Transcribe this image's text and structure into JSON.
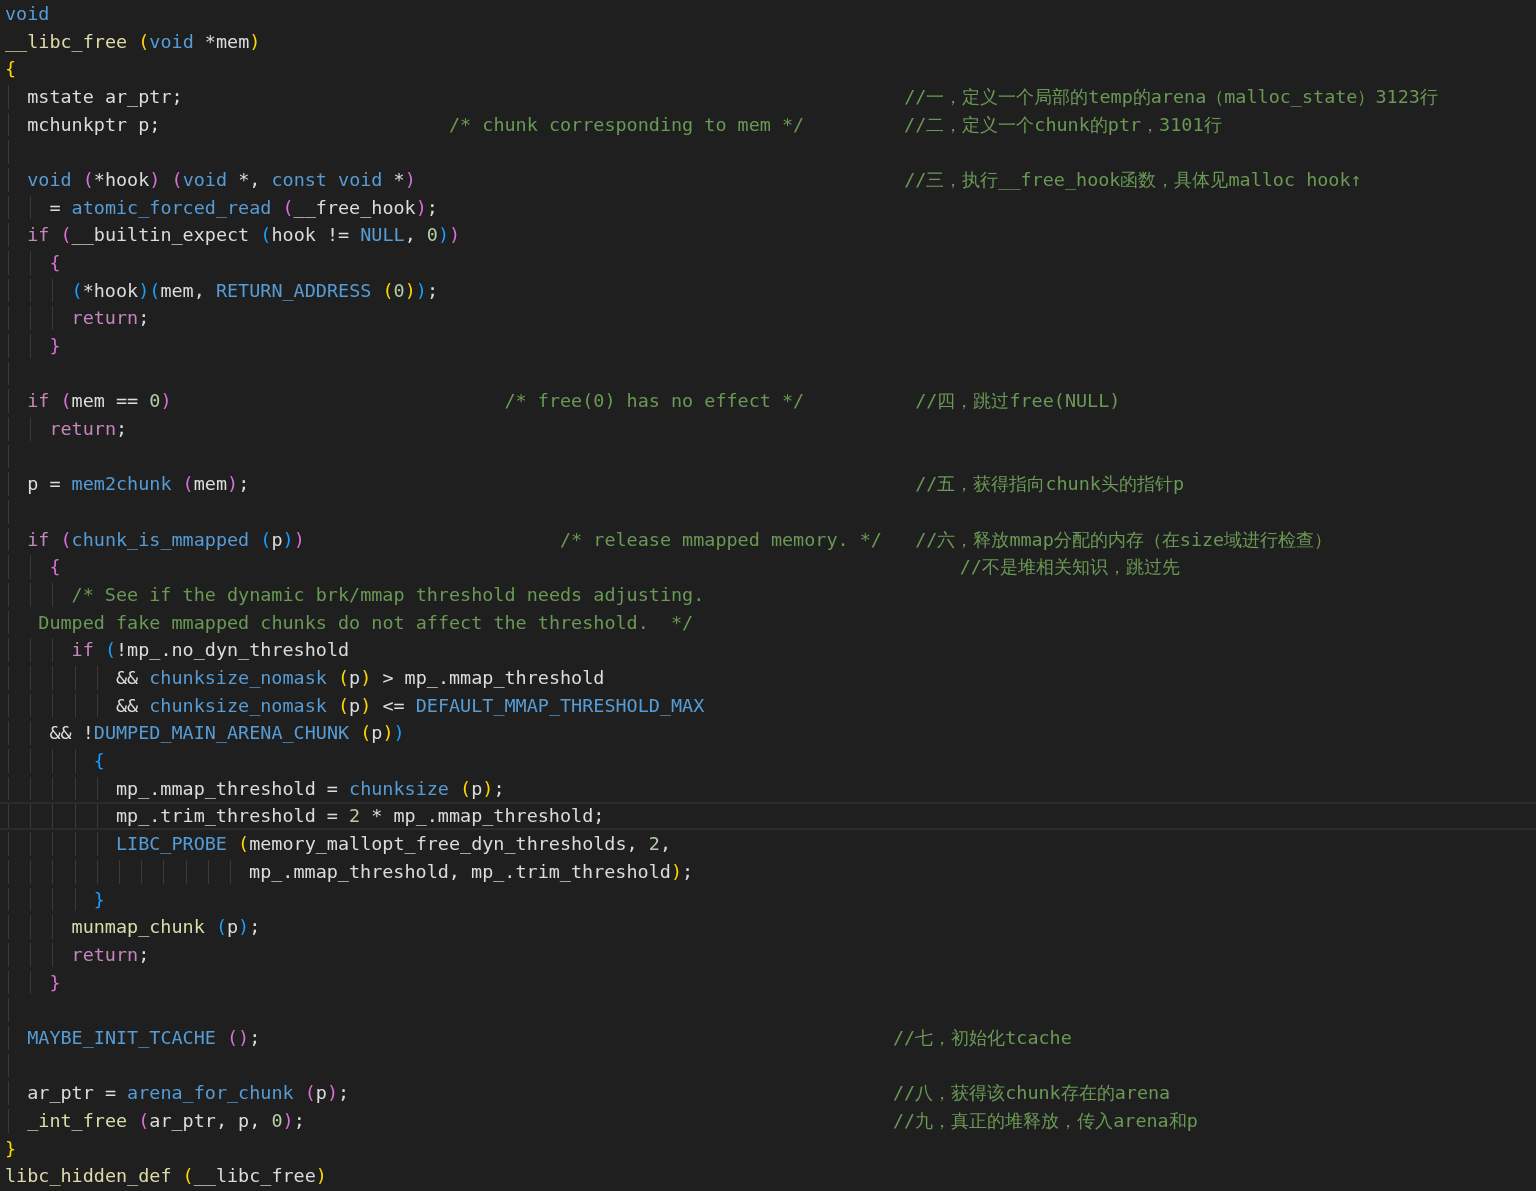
{
  "lines": [
    {
      "current": false,
      "tokens": [
        {
          "kind": "keyword",
          "text": "void"
        }
      ]
    },
    {
      "current": false,
      "tokens": [
        {
          "kind": "function",
          "text": "__libc_free "
        },
        {
          "kind": "bracket1",
          "text": "("
        },
        {
          "kind": "keyword",
          "text": "void"
        },
        {
          "kind": "plain",
          "text": " *mem"
        },
        {
          "kind": "bracket1",
          "text": ")"
        }
      ]
    },
    {
      "current": false,
      "tokens": [
        {
          "kind": "bracket1",
          "text": "{"
        }
      ]
    },
    {
      "current": false,
      "tokens": [
        {
          "kind": "plain",
          "text": "mstate ar_ptr;"
        }
      ],
      "note": "//一，定义一个局部的temp的arena（malloc_state）3123行"
    },
    {
      "current": false,
      "tokens": [
        {
          "kind": "plain",
          "text": "mchunkptr p;"
        }
      ],
      "comment": "/* chunk corresponding to mem */",
      "note": "//二，定义一个chunk的ptr，3101行"
    },
    {
      "current": false
    },
    {
      "current": false,
      "tokens": [
        {
          "kind": "keyword",
          "text": "void "
        },
        {
          "kind": "bracket2",
          "text": "("
        },
        {
          "kind": "plain",
          "text": "*hook"
        },
        {
          "kind": "bracket2",
          "text": ") "
        },
        {
          "kind": "bracket2",
          "text": "("
        },
        {
          "kind": "keyword",
          "text": "void"
        },
        {
          "kind": "plain",
          "text": " *, "
        },
        {
          "kind": "keyword",
          "text": "const void"
        },
        {
          "kind": "plain",
          "text": " *"
        },
        {
          "kind": "bracket2",
          "text": ")"
        }
      ],
      "note": "//三，执行__free_hook函数，具体见malloc hook↑"
    },
    {
      "current": false,
      "tokens": [
        {
          "kind": "plain",
          "text": "= "
        },
        {
          "kind": "macro",
          "text": "atomic_forced_read "
        },
        {
          "kind": "bracket2",
          "text": "("
        },
        {
          "kind": "plain",
          "text": "__free_hook"
        },
        {
          "kind": "bracket2",
          "text": ")"
        },
        {
          "kind": "plain",
          "text": ";"
        }
      ]
    },
    {
      "current": false,
      "tokens": [
        {
          "kind": "control",
          "text": "if "
        },
        {
          "kind": "bracket2",
          "text": "("
        },
        {
          "kind": "plain",
          "text": "__builtin_expect "
        },
        {
          "kind": "bracket3",
          "text": "("
        },
        {
          "kind": "plain",
          "text": "hook != "
        },
        {
          "kind": "macro",
          "text": "NULL"
        },
        {
          "kind": "plain",
          "text": ", "
        },
        {
          "kind": "number",
          "text": "0"
        },
        {
          "kind": "bracket3",
          "text": ")"
        },
        {
          "kind": "bracket2",
          "text": ")"
        }
      ]
    },
    {
      "current": false,
      "tokens": [
        {
          "kind": "bracket2",
          "text": "{"
        }
      ]
    },
    {
      "current": false,
      "tokens": [
        {
          "kind": "bracket3",
          "text": "("
        },
        {
          "kind": "plain",
          "text": "*hook"
        },
        {
          "kind": "bracket3",
          "text": ")"
        },
        {
          "kind": "bracket3",
          "text": "("
        },
        {
          "kind": "plain",
          "text": "mem, "
        },
        {
          "kind": "macro",
          "text": "RETURN_ADDRESS "
        },
        {
          "kind": "bracket1",
          "text": "("
        },
        {
          "kind": "number",
          "text": "0"
        },
        {
          "kind": "bracket1",
          "text": ")"
        },
        {
          "kind": "bracket3",
          "text": ")"
        },
        {
          "kind": "plain",
          "text": ";"
        }
      ]
    },
    {
      "current": false,
      "tokens": [
        {
          "kind": "control",
          "text": "return"
        },
        {
          "kind": "plain",
          "text": ";"
        }
      ]
    },
    {
      "current": false,
      "tokens": [
        {
          "kind": "bracket2",
          "text": "}"
        }
      ]
    },
    {
      "current": false
    },
    {
      "current": false,
      "tokens": [
        {
          "kind": "control",
          "text": "if "
        },
        {
          "kind": "bracket2",
          "text": "("
        },
        {
          "kind": "plain",
          "text": "mem == "
        },
        {
          "kind": "number",
          "text": "0"
        },
        {
          "kind": "bracket2",
          "text": ")"
        }
      ],
      "comment": "/* free(0) has no effect */",
      "note": "//四，跳过free(NULL)"
    },
    {
      "current": false,
      "tokens": [
        {
          "kind": "control",
          "text": "return"
        },
        {
          "kind": "plain",
          "text": ";"
        }
      ]
    },
    {
      "current": false
    },
    {
      "current": false,
      "tokens": [
        {
          "kind": "plain",
          "text": "p = "
        },
        {
          "kind": "macro",
          "text": "mem2chunk "
        },
        {
          "kind": "bracket2",
          "text": "("
        },
        {
          "kind": "plain",
          "text": "mem"
        },
        {
          "kind": "bracket2",
          "text": ")"
        },
        {
          "kind": "plain",
          "text": ";"
        }
      ],
      "note": "//五，获得指向chunk头的指针p"
    },
    {
      "current": false
    },
    {
      "current": false,
      "tokens": [
        {
          "kind": "control",
          "text": "if "
        },
        {
          "kind": "bracket2",
          "text": "("
        },
        {
          "kind": "macro",
          "text": "chunk_is_mmapped "
        },
        {
          "kind": "bracket3",
          "text": "("
        },
        {
          "kind": "plain",
          "text": "p"
        },
        {
          "kind": "bracket3",
          "text": ")"
        },
        {
          "kind": "bracket2",
          "text": ")"
        }
      ],
      "comment": "/* release mmapped memory. */",
      "note": "//六，释放mmap分配的内存（在size域进行检查）"
    },
    {
      "current": false,
      "tokens": [
        {
          "kind": "bracket2",
          "text": "{"
        }
      ],
      "note": "//不是堆相关知识，跳过先"
    },
    {
      "current": false,
      "tokens": [
        {
          "kind": "comment",
          "text": "/* See if the dynamic brk/mmap threshold needs adjusting."
        }
      ]
    },
    {
      "current": false,
      "tokens": [
        {
          "kind": "comment",
          "text": "Dumped fake mmapped chunks do not affect the threshold.  */"
        }
      ]
    },
    {
      "current": false,
      "tokens": [
        {
          "kind": "control",
          "text": "if "
        },
        {
          "kind": "bracket3",
          "text": "("
        },
        {
          "kind": "plain",
          "text": "!mp_.no_dyn_threshold"
        }
      ]
    },
    {
      "current": false,
      "tokens": [
        {
          "kind": "plain",
          "text": "&& "
        },
        {
          "kind": "macro",
          "text": "chunksize_nomask "
        },
        {
          "kind": "bracket1",
          "text": "("
        },
        {
          "kind": "plain",
          "text": "p"
        },
        {
          "kind": "bracket1",
          "text": ")"
        },
        {
          "kind": "plain",
          "text": " > mp_.mmap_threshold"
        }
      ]
    },
    {
      "current": false,
      "tokens": [
        {
          "kind": "plain",
          "text": "&& "
        },
        {
          "kind": "macro",
          "text": "chunksize_nomask "
        },
        {
          "kind": "bracket1",
          "text": "("
        },
        {
          "kind": "plain",
          "text": "p"
        },
        {
          "kind": "bracket1",
          "text": ")"
        },
        {
          "kind": "plain",
          "text": " <= "
        },
        {
          "kind": "macro",
          "text": "DEFAULT_MMAP_THRESHOLD_MAX"
        }
      ]
    },
    {
      "current": false,
      "tokens": [
        {
          "kind": "plain",
          "text": "&& !"
        },
        {
          "kind": "macro",
          "text": "DUMPED_MAIN_ARENA_CHUNK "
        },
        {
          "kind": "bracket1",
          "text": "("
        },
        {
          "kind": "plain",
          "text": "p"
        },
        {
          "kind": "bracket1",
          "text": ")"
        },
        {
          "kind": "bracket3",
          "text": ")"
        }
      ]
    },
    {
      "current": false,
      "tokens": [
        {
          "kind": "bracket3",
          "text": "{"
        }
      ]
    },
    {
      "current": false,
      "tokens": [
        {
          "kind": "plain",
          "text": "mp_.mmap_threshold = "
        },
        {
          "kind": "macro",
          "text": "chunksize "
        },
        {
          "kind": "bracket1",
          "text": "("
        },
        {
          "kind": "plain",
          "text": "p"
        },
        {
          "kind": "bracket1",
          "text": ")"
        },
        {
          "kind": "plain",
          "text": ";"
        }
      ]
    },
    {
      "current": true,
      "tokens": [
        {
          "kind": "plain",
          "text": "mp_.trim_threshold = "
        },
        {
          "kind": "number",
          "text": "2"
        },
        {
          "kind": "plain",
          "text": " * mp_.mmap_threshold;"
        }
      ]
    },
    {
      "current": false,
      "tokens": [
        {
          "kind": "macro",
          "text": "LIBC_PROBE "
        },
        {
          "kind": "bracket1",
          "text": "("
        },
        {
          "kind": "plain",
          "text": "memory_mallopt_free_dyn_thresholds, "
        },
        {
          "kind": "number",
          "text": "2"
        },
        {
          "kind": "plain",
          "text": ","
        }
      ]
    },
    {
      "current": false,
      "tokens": [
        {
          "kind": "plain",
          "text": "mp_.mmap_threshold, mp_.trim_threshold"
        },
        {
          "kind": "bracket1",
          "text": ")"
        },
        {
          "kind": "plain",
          "text": ";"
        }
      ]
    },
    {
      "current": false,
      "tokens": [
        {
          "kind": "bracket3",
          "text": "}"
        }
      ]
    },
    {
      "current": false,
      "tokens": [
        {
          "kind": "function",
          "text": "munmap_chunk "
        },
        {
          "kind": "bracket3",
          "text": "("
        },
        {
          "kind": "plain",
          "text": "p"
        },
        {
          "kind": "bracket3",
          "text": ")"
        },
        {
          "kind": "plain",
          "text": ";"
        }
      ]
    },
    {
      "current": false,
      "tokens": [
        {
          "kind": "control",
          "text": "return"
        },
        {
          "kind": "plain",
          "text": ";"
        }
      ]
    },
    {
      "current": false,
      "tokens": [
        {
          "kind": "bracket2",
          "text": "}"
        }
      ]
    },
    {
      "current": false
    },
    {
      "current": false,
      "tokens": [
        {
          "kind": "macro",
          "text": "MAYBE_INIT_TCACHE "
        },
        {
          "kind": "bracket2",
          "text": "()"
        },
        {
          "kind": "plain",
          "text": ";"
        }
      ],
      "note": "//七，初始化tcache"
    },
    {
      "current": false
    },
    {
      "current": false,
      "tokens": [
        {
          "kind": "plain",
          "text": "ar_ptr = "
        },
        {
          "kind": "macro",
          "text": "arena_for_chunk "
        },
        {
          "kind": "bracket2",
          "text": "("
        },
        {
          "kind": "plain",
          "text": "p"
        },
        {
          "kind": "bracket2",
          "text": ")"
        },
        {
          "kind": "plain",
          "text": ";"
        }
      ],
      "note": "//八，获得该chunk存在的arena"
    },
    {
      "current": false,
      "tokens": [
        {
          "kind": "function",
          "text": "_int_free "
        },
        {
          "kind": "bracket2",
          "text": "("
        },
        {
          "kind": "plain",
          "text": "ar_ptr, p, "
        },
        {
          "kind": "number",
          "text": "0"
        },
        {
          "kind": "bracket2",
          "text": ")"
        },
        {
          "kind": "plain",
          "text": ";"
        }
      ],
      "note": "//九，真正的堆释放，传入arena和p"
    },
    {
      "current": false,
      "tokens": [
        {
          "kind": "bracket1",
          "text": "}"
        }
      ]
    },
    {
      "current": false,
      "tokens": [
        {
          "kind": "function",
          "text": "libc_hidden_def "
        },
        {
          "kind": "bracket1",
          "text": "("
        },
        {
          "kind": "plain",
          "text": "__libc_free"
        },
        {
          "kind": "bracket1",
          "text": ")"
        }
      ]
    }
  ]
}
